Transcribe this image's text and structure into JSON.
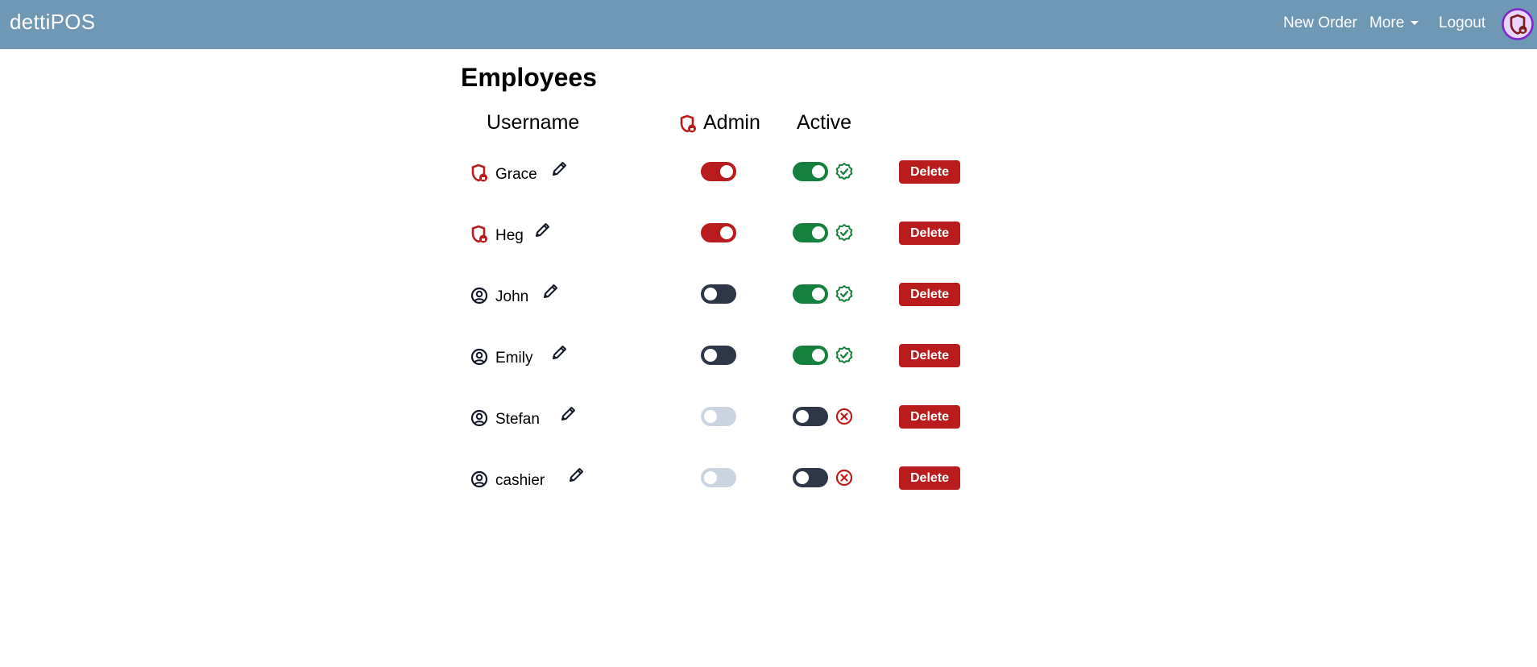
{
  "app": {
    "brand": "dettiPOS"
  },
  "nav": {
    "new_order": "New Order",
    "more": "More",
    "logout": "Logout"
  },
  "page": {
    "title": "Employees"
  },
  "columns": {
    "username": "Username",
    "admin": "Admin",
    "active": "Active"
  },
  "colors": {
    "navbar": "#6f98b5",
    "admin_on": "#b91c1c",
    "active_on": "#15803d",
    "toggle_off_dark": "#2d3748",
    "toggle_disabled": "#cbd5e1",
    "delete_button": "#b91c1c"
  },
  "employees": [
    {
      "username": "Grace",
      "role_icon": "admin-shield-icon",
      "admin": true,
      "active": true,
      "status_icon": "verified-check-icon",
      "delete_label": "Delete"
    },
    {
      "username": "Heg",
      "role_icon": "admin-shield-icon",
      "admin": true,
      "active": true,
      "status_icon": "verified-check-icon",
      "delete_label": "Delete"
    },
    {
      "username": "John",
      "role_icon": "user-circle-icon",
      "admin": false,
      "active": true,
      "status_icon": "verified-check-icon",
      "delete_label": "Delete"
    },
    {
      "username": "Emily",
      "role_icon": "user-circle-icon",
      "admin": false,
      "active": true,
      "status_icon": "verified-check-icon",
      "delete_label": "Delete"
    },
    {
      "username": "Stefan",
      "role_icon": "user-circle-icon",
      "admin": false,
      "active": false,
      "status_icon": "x-circle-icon",
      "delete_label": "Delete"
    },
    {
      "username": "cashier",
      "role_icon": "user-circle-icon",
      "admin": false,
      "active": false,
      "status_icon": "x-circle-icon",
      "delete_label": "Delete"
    }
  ]
}
